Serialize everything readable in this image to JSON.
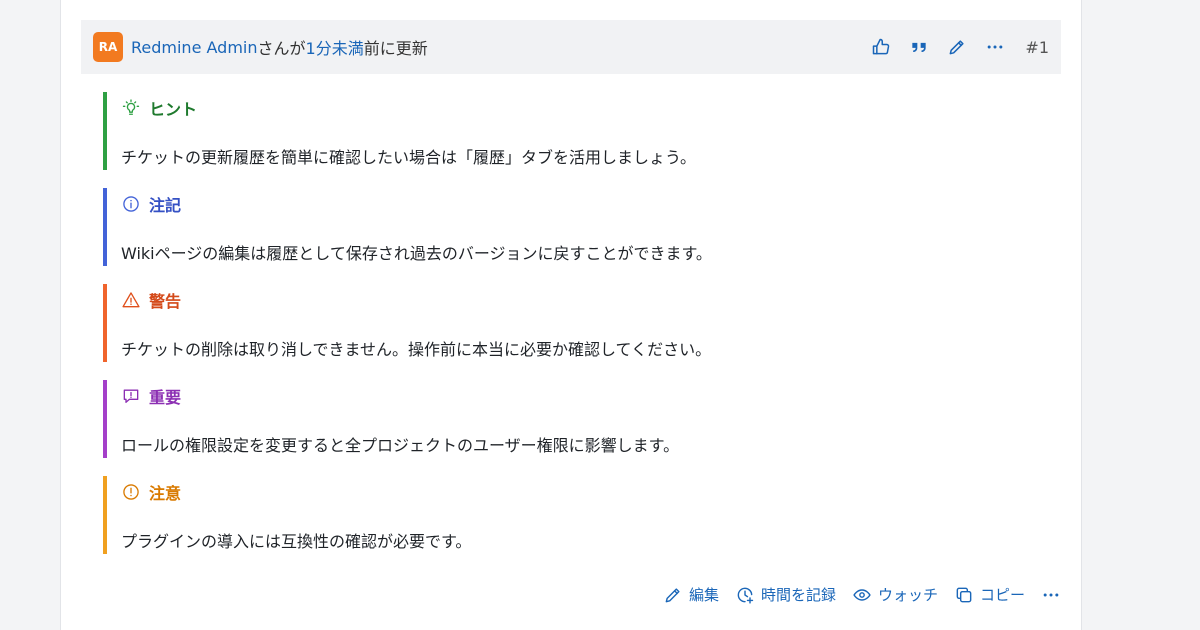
{
  "journal": {
    "avatar_initials": "RA",
    "author": "Redmine Admin",
    "by_text": " さんが",
    "time_link": "1分未満",
    "time_suffix": "前に更新",
    "number": "#1",
    "actions": [
      "like-icon",
      "quote-icon",
      "edit-icon",
      "more-icon"
    ]
  },
  "alerts": [
    {
      "type": "tip",
      "title": "ヒント",
      "icon": "lightbulb-icon",
      "color": "#2ea043",
      "body": "チケットの更新履歴を簡単に確認したい場合は「履歴」タブを活用しましょう。"
    },
    {
      "type": "note",
      "title": "注記",
      "icon": "info-icon",
      "color": "#4363d8",
      "body": "Wikiページの編集は履歴として保存され過去のバージョンに戻すことができます。"
    },
    {
      "type": "warning",
      "title": "警告",
      "icon": "warning-triangle-icon",
      "color": "#f0642c",
      "body": "チケットの削除は取り消しできません。操作前に本当に必要か確認してください。"
    },
    {
      "type": "important",
      "title": "重要",
      "icon": "message-alert-icon",
      "color": "#a43fc9",
      "body": "ロールの権限設定を変更すると全プロジェクトのユーザー権限に影響します。"
    },
    {
      "type": "caution",
      "title": "注意",
      "icon": "exclamation-circle-icon",
      "color": "#f0a020",
      "body": "プラグインの導入には互換性の確認が必要です。"
    }
  ],
  "footer": {
    "edit_label": "編集",
    "log_time_label": "時間を記録",
    "watch_label": "ウォッチ",
    "copy_label": "コピー"
  },
  "colors": {
    "link": "#1a66b8",
    "avatar_bg": "#f27a20",
    "header_bg": "#f1f2f4"
  }
}
